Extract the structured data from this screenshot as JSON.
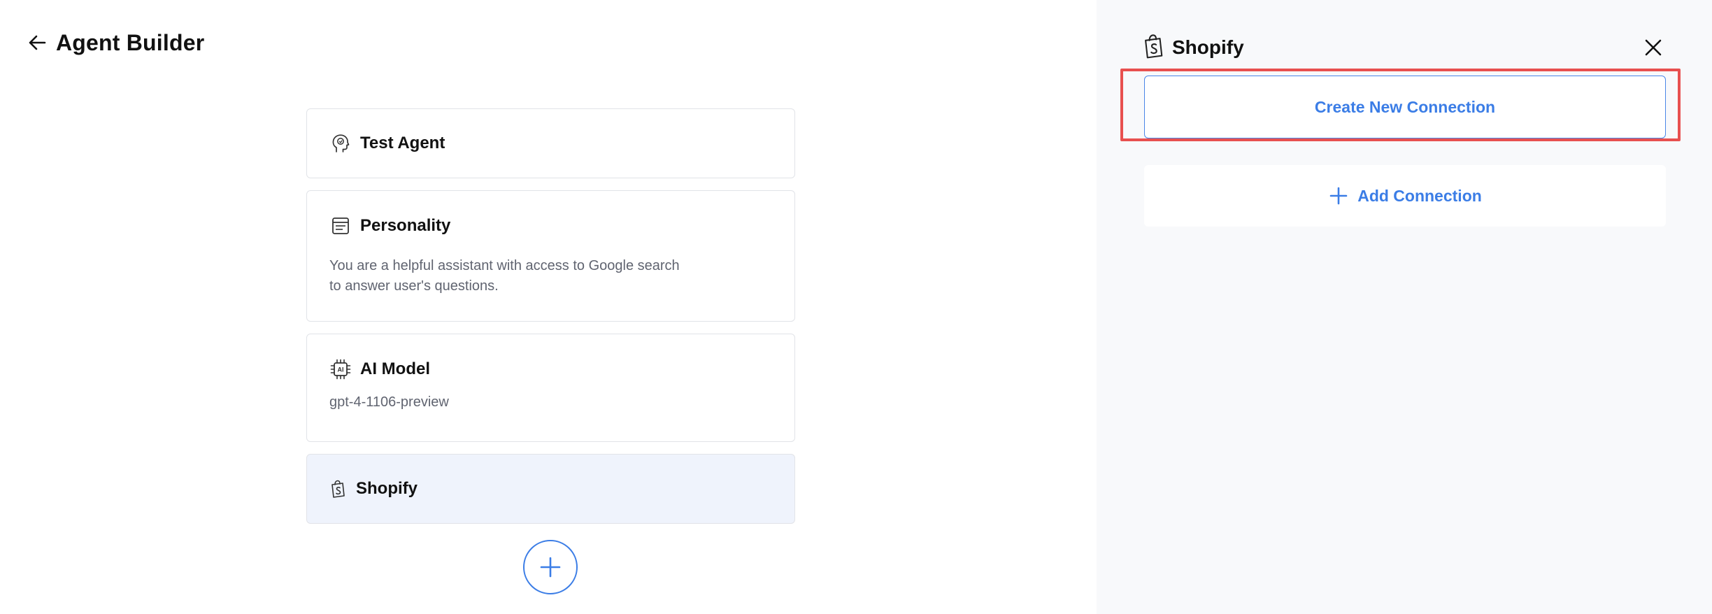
{
  "header": {
    "title": "Agent Builder",
    "back_icon": "arrow-left-icon"
  },
  "cards": {
    "test_agent": {
      "title": "Test Agent",
      "icon": "head-icon"
    },
    "personality": {
      "title": "Personality",
      "icon": "document-icon",
      "description": "You are a helpful assistant with access to Google search to answer user's questions."
    },
    "ai_model": {
      "title": "AI Model",
      "icon": "ai-chip-icon",
      "value": "gpt-4-1106-preview"
    },
    "shopify": {
      "title": "Shopify",
      "icon": "shopify-bag-icon",
      "selected": true
    }
  },
  "add_step": {
    "icon": "plus-icon"
  },
  "panel": {
    "title": "Shopify",
    "icon": "shopify-bag-icon",
    "close_icon": "close-icon",
    "create_button": "Create New Connection",
    "add_button": "Add Connection",
    "add_icon": "plus-icon"
  },
  "colors": {
    "accent": "#3b7de6",
    "highlight": "#e8504f",
    "selected_card_bg": "#eff3fc",
    "panel_bg": "#f8f9fb",
    "muted_text": "#606470"
  }
}
